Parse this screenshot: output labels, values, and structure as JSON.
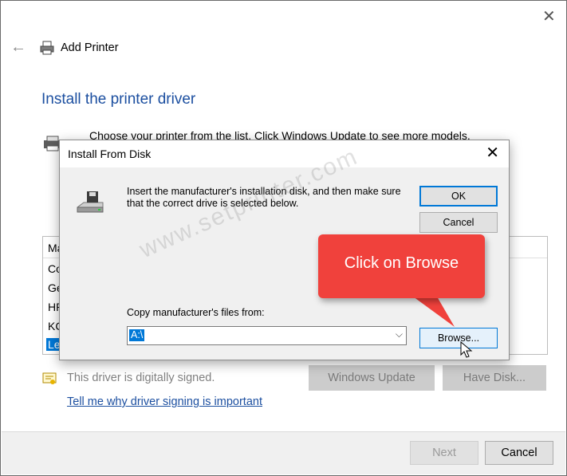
{
  "window": {
    "title": "Add Printer",
    "page_title": "Install the printer driver",
    "instruction": "Choose your printer from the list. Click Windows Update to see more models."
  },
  "list": {
    "header": "Ma",
    "items": [
      "Co",
      "Ge",
      "HP",
      "KC",
      "Le"
    ],
    "selected_index": 4
  },
  "signature": {
    "text": "This driver is digitally signed.",
    "link": "Tell me why driver signing is important"
  },
  "buttons": {
    "windows_update": "Windows Update",
    "have_disk": "Have Disk...",
    "next": "Next",
    "cancel": "Cancel"
  },
  "dialog": {
    "title": "Install From Disk",
    "message": "Insert the manufacturer's installation disk, and then make sure that the correct drive is selected below.",
    "ok": "OK",
    "cancel": "Cancel",
    "copy_label": "Copy manufacturer's files from:",
    "path_value": "A:\\",
    "browse": "Browse..."
  },
  "callout": {
    "text": "Click on Browse",
    "color": "#f0413c"
  },
  "watermark": "www.setprinter.com",
  "colors": {
    "title_blue": "#1c4fa0",
    "selection": "#0078d7"
  }
}
